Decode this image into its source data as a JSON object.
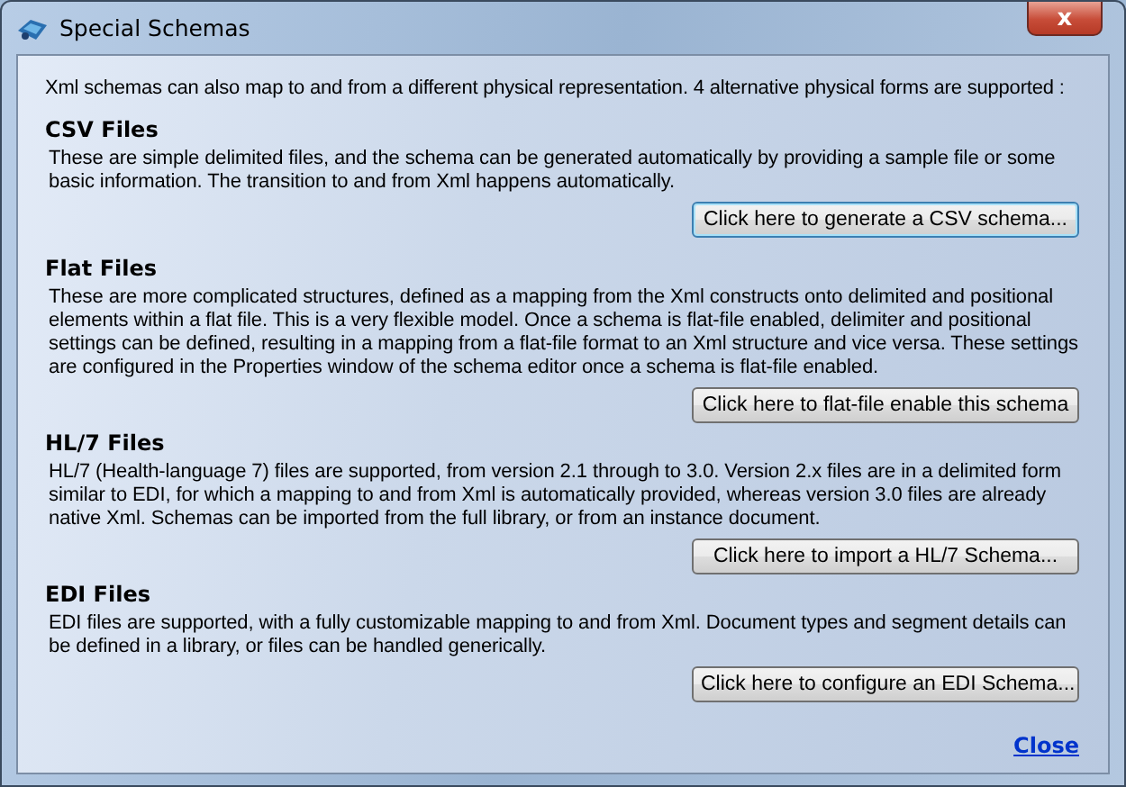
{
  "window": {
    "title": "Special Schemas",
    "close_glyph": "x"
  },
  "intro": "Xml schemas can also map to and from a different physical representation.  4 alternative physical forms are supported :",
  "sections": [
    {
      "heading": "CSV Files",
      "text": "These are simple delimited files, and the schema can be generated automatically by providing a sample file or some basic information.  The transition to and from Xml happens automatically.",
      "button": {
        "label": "Click here to generate a CSV schema...",
        "focused": true
      }
    },
    {
      "heading": "Flat Files",
      "text": "These are more complicated structures, defined as a mapping from the Xml constructs onto delimited and positional elements within a flat file.  This is a very flexible model.  Once a schema is flat-file enabled, delimiter and positional settings can be defined, resulting in a mapping from a flat-file format to an Xml structure and vice versa.  These settings are configured in the Properties window of the schema editor once a schema is flat-file enabled.",
      "button": {
        "label": "Click here to flat-file enable this schema",
        "focused": false
      }
    },
    {
      "heading": "HL/7 Files",
      "text": "HL/7 (Health-language 7) files are supported, from version 2.1 through to 3.0.  Version 2.x files are in a delimited form similar to EDI, for which a mapping to and from Xml is automatically provided, whereas version 3.0 files are already native Xml. Schemas can be imported from the full library, or from an instance document.",
      "button": {
        "label": "Click here to import a HL/7 Schema...",
        "focused": false
      }
    },
    {
      "heading": "EDI Files",
      "text": "EDI files are supported, with a fully customizable mapping to and from Xml.  Document types and segment details can be defined in a library, or files can be handled generically.",
      "button": {
        "label": "Click here to configure an EDI Schema...",
        "focused": false
      }
    }
  ],
  "close_link": "Close"
}
